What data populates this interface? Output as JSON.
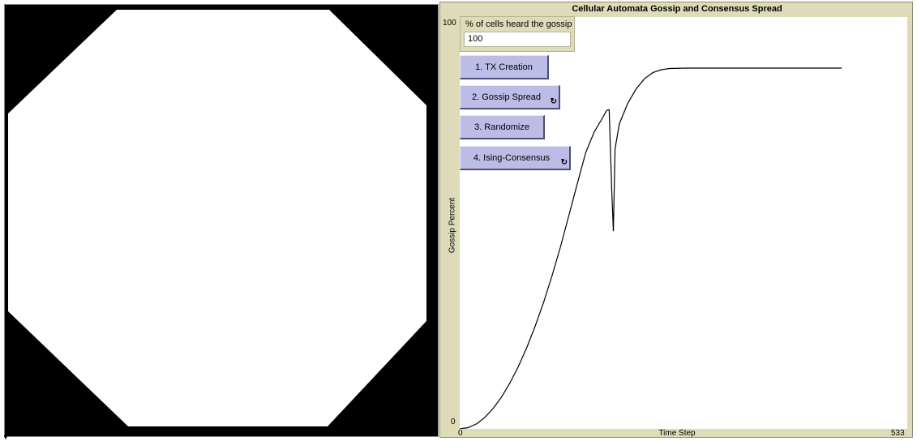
{
  "plot": {
    "title": "Cellular Automata Gossip and Consensus Spread",
    "ylabel": "Gossip Percent",
    "xlabel": "Time Step",
    "ymin": "0",
    "ymax": "100",
    "xmin": "0",
    "xmax": "533"
  },
  "monitor": {
    "label": "% of cells heard the gossip",
    "value": "100"
  },
  "buttons": {
    "tx_creation": "1. TX Creation",
    "gossip_spread": "2. Gossip Spread",
    "randomize": "3. Randomize",
    "ising_consensus": "4. Ising-Consensus",
    "forever_icon": "arrows-cycle-icon"
  },
  "colors": {
    "world_bg": "#000000",
    "patch_on": "#ffffff",
    "button_face": "#bcbce6",
    "panel_bg": "#dedcb8"
  },
  "chart_data": {
    "type": "line",
    "title": "Cellular Automata Gossip and Consensus Spread",
    "xlabel": "Time Step",
    "ylabel": "Gossip Percent",
    "xlim": [
      0,
      533
    ],
    "ylim": [
      0,
      100
    ],
    "series": [
      {
        "x": [
          0,
          10,
          20,
          30,
          40,
          50,
          60,
          70,
          80,
          90,
          100,
          110,
          120,
          130,
          140,
          150,
          160,
          170,
          175,
          178,
          181,
          183,
          185,
          190,
          200,
          210,
          220,
          230,
          240,
          250,
          270,
          300,
          350,
          400,
          450,
          455
        ],
        "y": [
          0,
          0.3,
          1.2,
          2.8,
          5,
          7.8,
          11.2,
          15.2,
          19.8,
          25,
          30.8,
          37.2,
          44.2,
          51.8,
          59.5,
          67,
          72,
          75.5,
          77.3,
          77.5,
          58,
          48,
          68,
          74,
          79,
          82.5,
          85,
          86.5,
          87.2,
          87.5,
          87.6,
          87.6,
          87.6,
          87.6,
          87.6,
          87.6
        ]
      }
    ]
  }
}
